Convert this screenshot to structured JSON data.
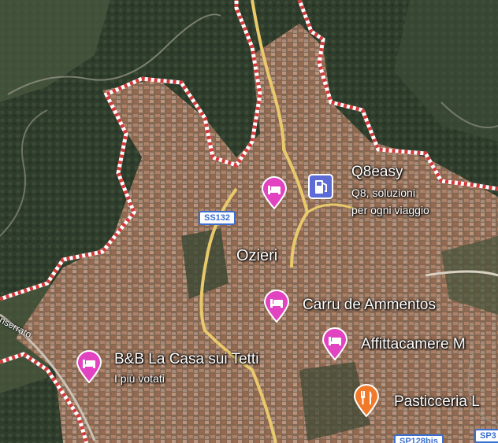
{
  "map": {
    "place_label": "Ozieri",
    "road_shields": [
      "SS132",
      "SP128bis",
      "SP3"
    ],
    "road_name_partial": "Monserrato",
    "pois": [
      {
        "name": "Q8easy",
        "subtitle_1": "Q8, soluzioni",
        "subtitle_2": "per ogni viaggio",
        "icon": "fuel-icon",
        "color": "#5c6bd6"
      },
      {
        "name": "Carru de Ammentos",
        "icon": "hotel-bed-icon",
        "color": "#e243c0"
      },
      {
        "name": "Affittacamere M",
        "icon": "hotel-bed-icon",
        "color": "#e243c0"
      },
      {
        "name": "B&B La Casa sui Tetti",
        "subtitle_1": "I più votati",
        "icon": "hotel-bed-icon",
        "color": "#e243c0"
      },
      {
        "name": "Pasticceria L",
        "icon": "restaurant-icon",
        "color": "#f07a2a"
      },
      {
        "name": "",
        "icon": "hotel-bed-icon",
        "color": "#e243c0"
      }
    ],
    "boundary_style": "red-white dashed",
    "imagery": "satellite"
  }
}
